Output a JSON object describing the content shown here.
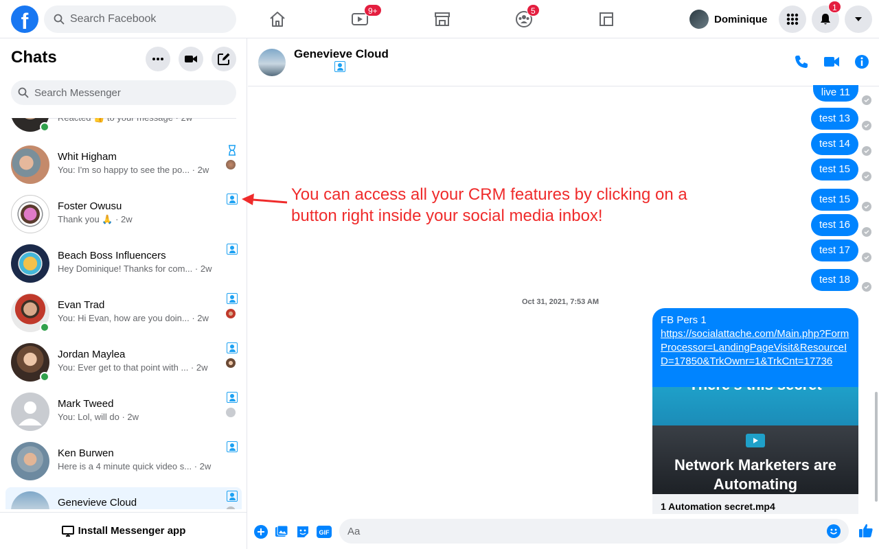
{
  "topbar": {
    "logo": "f",
    "search_placeholder": "Search Facebook",
    "watch_badge": "9+",
    "groups_badge": "5",
    "profile_name": "Dominique",
    "notifications_badge": "1"
  },
  "sidebar": {
    "title": "Chats",
    "search_placeholder": "Search Messenger",
    "install_label": "Install Messenger app",
    "chats": [
      {
        "name": "",
        "preview": "Reacted 👍 to your message · 2w",
        "online": true
      },
      {
        "name": "Whit Higham",
        "preview": "You: I'm so happy to see the po... · 2w",
        "online": false
      },
      {
        "name": "Foster Owusu",
        "preview": "Thank you 🙏 · 2w",
        "online": false
      },
      {
        "name": "Beach Boss Influencers",
        "preview": "Hey Dominique! Thanks for com... · 2w",
        "online": false
      },
      {
        "name": "Evan Trad",
        "preview": "You: Hi Evan, how are you doin... · 2w",
        "online": true
      },
      {
        "name": "Jordan Maylea",
        "preview": "You: Ever get to that point with ... · 2w",
        "online": true
      },
      {
        "name": "Mark Tweed",
        "preview": "You: Lol, will do · 2w",
        "online": false
      },
      {
        "name": "Ken Burwen",
        "preview": "Here is a 4 minute quick video s... · 2w",
        "online": false
      },
      {
        "name": "Genevieve Cloud",
        "preview": "",
        "online": false
      }
    ]
  },
  "conversation": {
    "contact_name": "Genevieve Cloud",
    "messages": [
      "live 11",
      "test 13",
      "test 14",
      "test 15",
      "test 15",
      "test 16",
      "test 17",
      "test 18"
    ],
    "timestamp": "Oct 31, 2021, 7:53 AM",
    "card": {
      "title": "FB Pers 1",
      "link": "https://socialattache.com/Main.php?FormProcessor=LandingPageVisit&ResourceID=17850&TrkOwnr=1&TrkCnt=17736",
      "image_top_text": "There's this secret",
      "video_title": "Network Marketers are Automating",
      "caption": "1 Automation secret.mp4"
    },
    "composer_placeholder": "Aa"
  },
  "annotation": "You can access all your CRM features by clicking on a button right inside your social media inbox!",
  "colors": {
    "brand": "#1877f2",
    "bubble": "#0084ff",
    "badge": "#e41e3f",
    "crm_icon": "#1da1f2",
    "annotation": "#ef2b2b"
  }
}
